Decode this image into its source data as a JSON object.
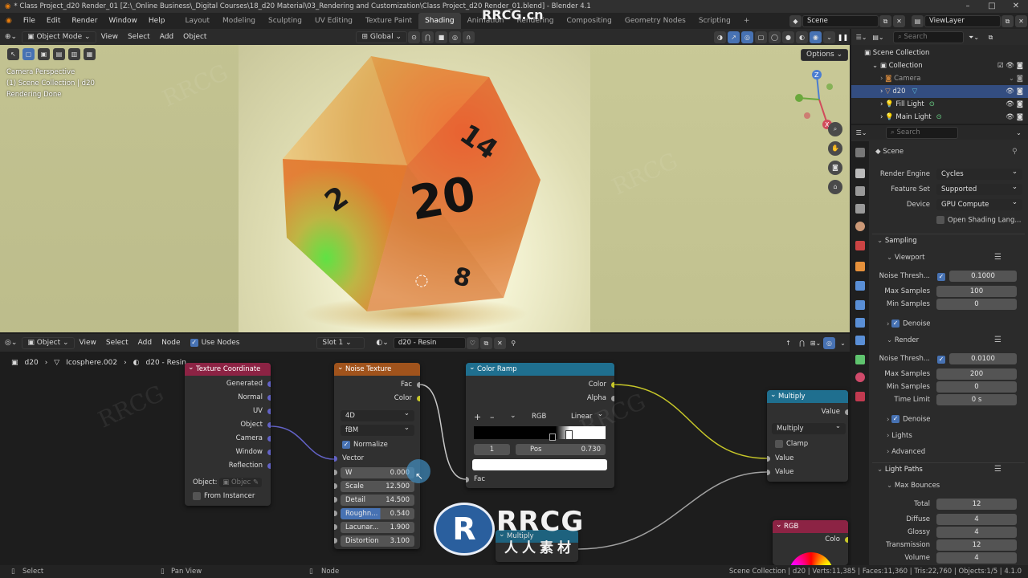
{
  "window": {
    "title": "* Class Project_d20 Render_01 [Z:\\_Online Business\\_Digital Courses\\18_d20 Material\\03_Rendering and Customization\\Class Project_d20 Render_01.blend] - Blender 4.1",
    "controls": [
      "–",
      "□",
      "✕"
    ]
  },
  "topbar": {
    "menus": [
      "File",
      "Edit",
      "Render",
      "Window",
      "Help"
    ],
    "workspaces": [
      "Layout",
      "Modeling",
      "Sculpting",
      "UV Editing",
      "Texture Paint",
      "Shading",
      "Animation",
      "Rendering",
      "Compositing",
      "Geometry Nodes",
      "Scripting"
    ],
    "active_workspace": "Shading",
    "add_tab": "+",
    "scene": "Scene",
    "view_layer": "ViewLayer"
  },
  "viewport_header": {
    "mode": "Object Mode",
    "menus": [
      "View",
      "Select",
      "Add",
      "Object"
    ],
    "transform": "Global",
    "options": "Options"
  },
  "viewport": {
    "overlay_lines": [
      "Camera Perspective",
      "(1) Scene Collection | d20",
      "Rendering Done"
    ],
    "die_numbers": [
      "20",
      "14",
      "2",
      "8"
    ]
  },
  "watermark": {
    "logo_text": "RRCG",
    "logo_sub": "人人素材",
    "top_text": "RRCG.cn"
  },
  "node_header": {
    "type": "Object",
    "menus": [
      "View",
      "Select",
      "Add",
      "Node"
    ],
    "use_nodes": "Use Nodes",
    "slot": "Slot 1",
    "material": "d20 - Resin"
  },
  "breadcrumb": [
    "d20",
    "Icosphere.002",
    "d20 - Resin"
  ],
  "nodes": {
    "texcoord": {
      "title": "Texture Coordinate",
      "outputs": [
        "Generated",
        "Normal",
        "UV",
        "Object",
        "Camera",
        "Window",
        "Reflection"
      ],
      "object_label": "Object:",
      "object_placeholder": "Objec",
      "from_instancer": "From Instancer"
    },
    "noise": {
      "title": "Noise Texture",
      "outputs": [
        "Fac",
        "Color"
      ],
      "dimensions": "4D",
      "type": "fBM",
      "normalize": "Normalize",
      "vector": "Vector",
      "fields": [
        {
          "label": "W",
          "value": "0.000"
        },
        {
          "label": "Scale",
          "value": "12.500"
        },
        {
          "label": "Detail",
          "value": "14.500"
        },
        {
          "label": "Roughn...",
          "value": "0.540"
        },
        {
          "label": "Lacunar...",
          "value": "1.900"
        },
        {
          "label": "Distortion",
          "value": "3.100"
        }
      ]
    },
    "colorramp": {
      "title": "Color Ramp",
      "outputs": [
        "Color",
        "Alpha"
      ],
      "add": "+",
      "remove": "–",
      "mode": "RGB",
      "interpolation": "Linear",
      "stop_index": "1",
      "pos_label": "Pos",
      "pos_value": "0.730",
      "input": "Fac"
    },
    "multiply": {
      "title": "Multiply",
      "output": "Value",
      "operation": "Multiply",
      "clamp": "Clamp",
      "inputs": [
        "Value",
        "Value"
      ]
    },
    "rgb": {
      "title": "RGB",
      "output": "Colo"
    },
    "multiply2": {
      "title": "Multiply"
    }
  },
  "outliner": {
    "search_placeholder": "Search",
    "rows": [
      {
        "label": "Scene Collection",
        "selected": false
      },
      {
        "label": "Collection",
        "selected": false
      },
      {
        "label": "Camera",
        "selected": false
      },
      {
        "label": "d20",
        "selected": true
      },
      {
        "label": "Fill Light",
        "selected": false
      },
      {
        "label": "Main Light",
        "selected": false
      }
    ]
  },
  "properties": {
    "search_placeholder": "Search",
    "context": "Scene",
    "render_engine_label": "Render Engine",
    "render_engine": "Cycles",
    "feature_set_label": "Feature Set",
    "feature_set": "Supported",
    "device_label": "Device",
    "device": "GPU Compute",
    "open_shading": "Open Shading Lang...",
    "sampling": "Sampling",
    "viewport": "Viewport",
    "vp_noise_label": "Noise Thresh...",
    "vp_noise": "0.1000",
    "vp_max_label": "Max Samples",
    "vp_max": "100",
    "vp_min_label": "Min Samples",
    "vp_min": "0",
    "denoise": "Denoise",
    "render": "Render",
    "r_noise_label": "Noise Thresh...",
    "r_noise": "0.0100",
    "r_max_label": "Max Samples",
    "r_max": "200",
    "r_min_label": "Min Samples",
    "r_min": "0",
    "time_limit_label": "Time Limit",
    "time_limit": "0 s",
    "denoise2": "Denoise",
    "lights": "Lights",
    "advanced": "Advanced",
    "light_paths": "Light Paths",
    "max_bounces": "Max Bounces",
    "bounces": [
      {
        "label": "Total",
        "value": "12"
      },
      {
        "label": "Diffuse",
        "value": "4"
      },
      {
        "label": "Glossy",
        "value": "4"
      },
      {
        "label": "Transmission",
        "value": "12"
      },
      {
        "label": "Volume",
        "value": "4"
      }
    ]
  },
  "statusbar": {
    "select": "Select",
    "pan": "Pan View",
    "node": "Node",
    "stats": "Scene Collection | d20 | Verts:11,385 | Faces:11,360 | Tris:22,760 | Objects:1/5 | 4.1.0"
  }
}
